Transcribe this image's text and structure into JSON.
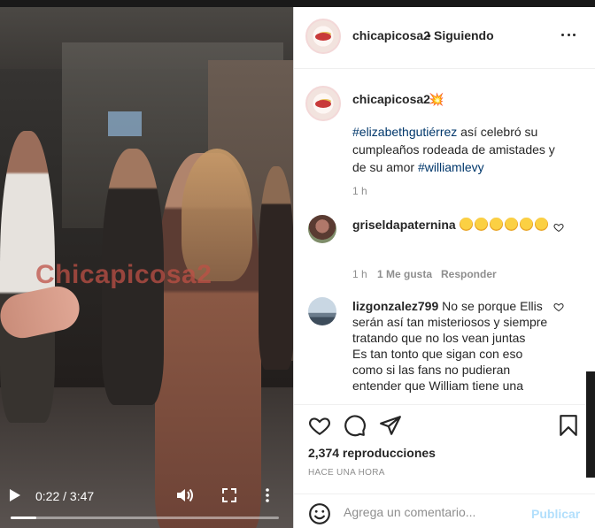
{
  "video": {
    "watermark": "Chicapicosa2",
    "time": "0:22 / 3:47",
    "progress": 0.097,
    "icons": [
      "play-icon",
      "volume-icon",
      "fullscreen-icon",
      "more-vertical-icon"
    ]
  },
  "header": {
    "username": "chicapicosa2",
    "dot": "•",
    "follow_status": "Siguiendo",
    "icons": [
      "avatar",
      "more-horizontal-icon"
    ]
  },
  "caption": {
    "username": "chicapicosa2",
    "emoji": "💥",
    "tag1": "#elizabethgutiérrez",
    "text1": " así celebró su cumpleaños rodeada de amistades y de su amor ",
    "tag2": "#williamlevy",
    "time": "1 h"
  },
  "comments": [
    {
      "username": "griseldapaternina",
      "emoji_count": 6,
      "time": "1 h",
      "likes": "1 Me gusta",
      "reply": "Responder"
    },
    {
      "username": "lizgonzalez799",
      "text": " No se porque Ellis serán así tan misteriosos y siempre tratando que no los vean juntas",
      "text2": "Es tan tonto que sigan con eso como si las fans no pudieran entender que William tiene una"
    }
  ],
  "actions": {
    "views": "2,374 reproducciones",
    "time_ago": "HACE UNA HORA",
    "icons": [
      "heart-icon",
      "comment-icon",
      "share-icon",
      "bookmark-icon"
    ]
  },
  "add_comment": {
    "placeholder": "Agrega un comentario...",
    "post_label": "Publicar"
  },
  "colors": {
    "link": "#00376b",
    "muted": "#8e8e8e",
    "post_disabled": "#b2dffc"
  }
}
